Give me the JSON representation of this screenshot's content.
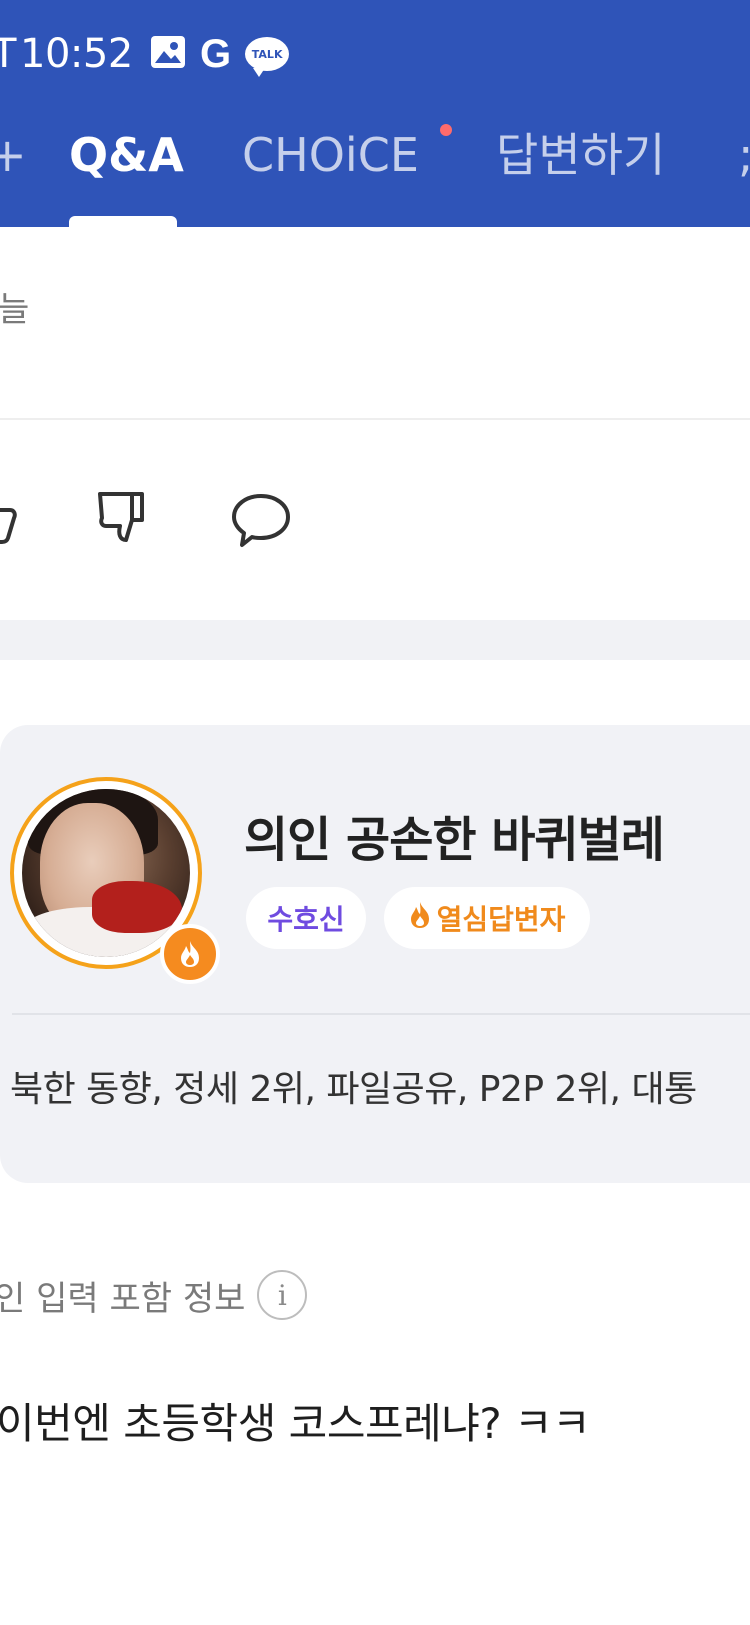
{
  "status_bar": {
    "edge_glyph": "T",
    "time": "10:52",
    "g_label": "G",
    "talk_label": "TALK"
  },
  "tabs": {
    "left_edge": "+",
    "items": [
      {
        "label": "Q&A",
        "active": true
      },
      {
        "label": "CHOiCE",
        "active": false,
        "has_new_dot": true
      },
      {
        "label": "답변하기",
        "active": false
      }
    ],
    "right_edge": ";"
  },
  "sort": {
    "label": "늘"
  },
  "answer_card": {
    "nickname": "의인 공손한 바퀴벌레",
    "badges": [
      "수호신",
      "열심답변자"
    ],
    "expertise": "북한 동향, 정세 2위, 파일공유, P2P 2위, 대통"
  },
  "ai_notice": {
    "label": "인 입력 포함 정보",
    "info_glyph": "i"
  },
  "answer": {
    "text": "이번엔 초등학생 코스프레냐? ㅋㅋ"
  },
  "colors": {
    "header_bg": "#2f54b8",
    "accent_orange": "#f5a21a",
    "badge_purple": "#6f4be0",
    "new_dot": "#ff6b6b"
  }
}
